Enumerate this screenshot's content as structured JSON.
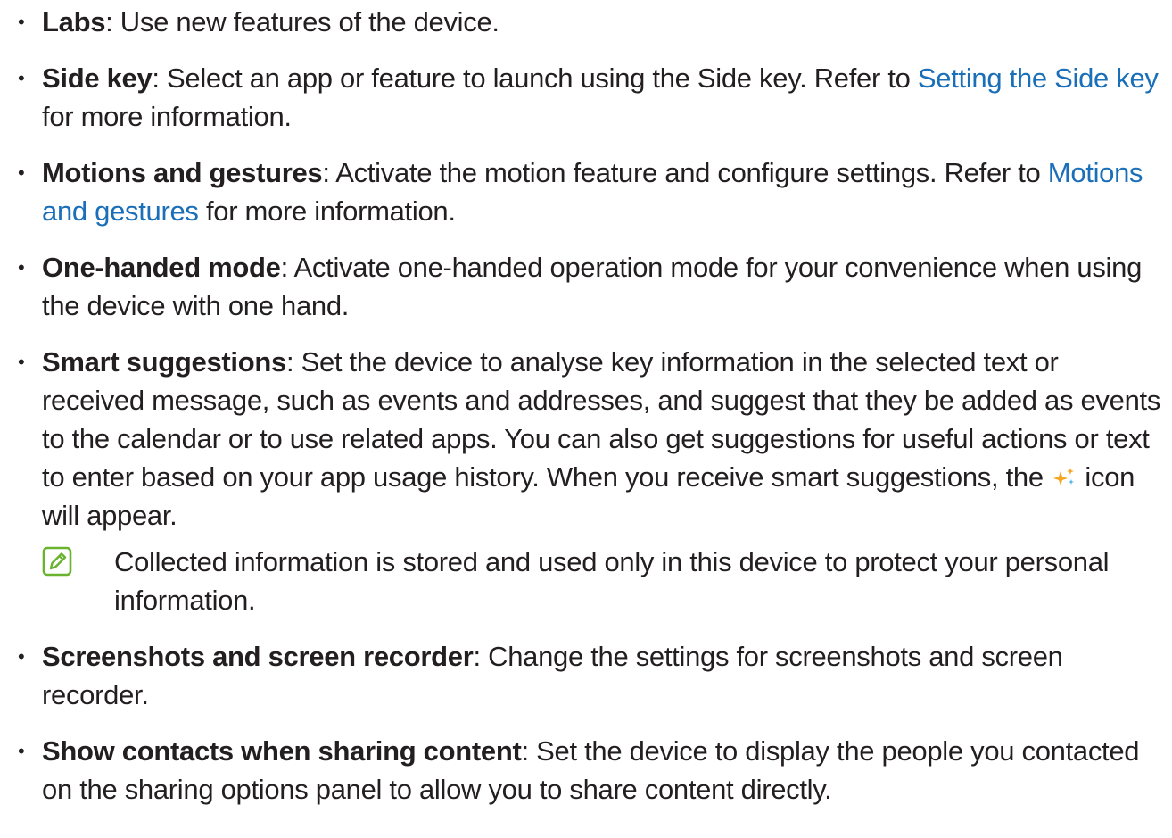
{
  "items": [
    {
      "term": "Labs",
      "pre": ": Use new features of the device.",
      "link": "",
      "post": ""
    },
    {
      "term": "Side key",
      "pre": ": Select an app or feature to launch using the Side key. Refer to ",
      "link": "Setting the Side key",
      "post": " for more information."
    },
    {
      "term": "Motions and gestures",
      "pre": ": Activate the motion feature and configure settings. Refer to ",
      "link": "Motions and gestures",
      "post": " for more information."
    },
    {
      "term": "One-handed mode",
      "pre": ": Activate one-handed operation mode for your convenience when using the device with one hand.",
      "link": "",
      "post": ""
    },
    {
      "term": "Smart suggestions",
      "pre": ": Set the device to analyse key information in the selected text or received message, such as events and addresses, and suggest that they be added as events to the calendar or to use related apps. You can also get suggestions for useful actions or text to enter based on your app usage history. When you receive smart suggestions, the ",
      "icon": "sparkle-icon",
      "post": " icon will appear.",
      "note": "Collected information is stored and used only in this device to protect your personal information."
    },
    {
      "term": "Screenshots and screen recorder",
      "pre": ": Change the settings for screenshots and screen recorder.",
      "link": "",
      "post": ""
    },
    {
      "term": "Show contacts when sharing content",
      "pre": ": Set the device to display the people you contacted on the sharing options panel to allow you to share content directly.",
      "link": "",
      "post": ""
    }
  ],
  "bullet_glyph": "•",
  "colors": {
    "text": "#231f20",
    "link": "#1a6fb8",
    "note_icon": "#6ab32e",
    "sparkle": "#f5a623"
  }
}
